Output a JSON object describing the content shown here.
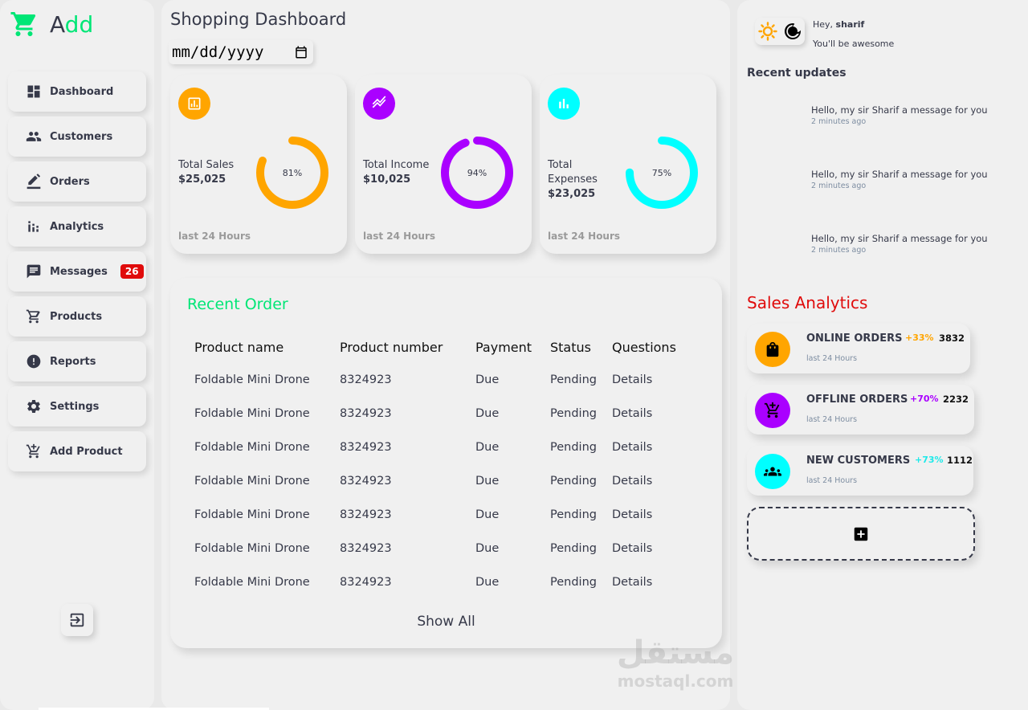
{
  "brand": {
    "first_letter": "A",
    "rest": "dd"
  },
  "sidebar": {
    "items": [
      {
        "label": "Dashboard",
        "icon": "dashboard-icon"
      },
      {
        "label": "Customers",
        "icon": "people-icon"
      },
      {
        "label": "Orders",
        "icon": "edit-icon"
      },
      {
        "label": "Analytics",
        "icon": "analytics-icon"
      },
      {
        "label": "Messages",
        "icon": "message-icon",
        "badge": "26"
      },
      {
        "label": "Products",
        "icon": "cart-icon"
      },
      {
        "label": "Reports",
        "icon": "report-icon"
      },
      {
        "label": "Settings",
        "icon": "settings-icon"
      },
      {
        "label": "Add Product",
        "icon": "add-cart-icon"
      }
    ],
    "logout_icon": "logout-icon"
  },
  "main": {
    "title": "Shopping Dashboard",
    "date_placeholder": "mm/dd/yyyy",
    "cards": [
      {
        "label": "Total Sales",
        "value": "$25,025",
        "percent": "81%",
        "fraction": 0.81,
        "color": "#ffa500",
        "footer": "last 24 Hours",
        "icon": "bar-chart-icon"
      },
      {
        "label": "Total Income",
        "value": "$10,025",
        "percent": "94%",
        "fraction": 0.94,
        "color": "#aa00ff",
        "footer": "last 24 Hours",
        "icon": "trending-icon"
      },
      {
        "label": "Total Expenses",
        "value": "$23,025",
        "percent": "75%",
        "fraction": 0.75,
        "color": "#00ffff",
        "footer": "last 24 Hours",
        "icon": "stats-icon"
      }
    ],
    "recent_order": {
      "title": "Recent Order",
      "headers": [
        "Product name",
        "Product number",
        "Payment",
        "Status",
        "Questions"
      ],
      "rows": [
        [
          "Foldable Mini Drone",
          "8324923",
          "Due",
          "Pending",
          "Details"
        ],
        [
          "Foldable Mini Drone",
          "8324923",
          "Due",
          "Pending",
          "Details"
        ],
        [
          "Foldable Mini Drone",
          "8324923",
          "Due",
          "Pending",
          "Details"
        ],
        [
          "Foldable Mini Drone",
          "8324923",
          "Due",
          "Pending",
          "Details"
        ],
        [
          "Foldable Mini Drone",
          "8324923",
          "Due",
          "Pending",
          "Details"
        ],
        [
          "Foldable Mini Drone",
          "8324923",
          "Due",
          "Pending",
          "Details"
        ],
        [
          "Foldable Mini Drone",
          "8324923",
          "Due",
          "Pending",
          "Details"
        ]
      ],
      "show_all": "Show All"
    },
    "watermark": {
      "arabic": "مستقل",
      "latin": "mostaql.com"
    }
  },
  "right": {
    "greeting_prefix": "Hey, ",
    "user": "sharif",
    "greeting_sub": "You'll be awesome",
    "recent_updates_title": "Recent updates",
    "updates": [
      {
        "message": "Hello, my sir Sharif a message for you",
        "time": "2 minutes ago"
      },
      {
        "message": "Hello, my sir Sharif a message for you",
        "time": "2 minutes ago"
      },
      {
        "message": "Hello, my sir Sharif a message for you",
        "time": "2 minutes ago"
      }
    ],
    "sales_analytics_title": "Sales Analytics",
    "analytics": [
      {
        "name": "ONLINE ORDERS",
        "growth": "+33%",
        "count": "3832",
        "sub": "last 24 Hours",
        "color": "#ffa500",
        "icon": "shopping-bag-icon"
      },
      {
        "name": "OFFLINE ORDERS",
        "growth": "+70%",
        "count": "2232",
        "sub": "last 24 Hours",
        "color": "#aa00ff",
        "icon": "add-cart-icon"
      },
      {
        "name": "NEW CUSTOMERS",
        "growth": "+73%",
        "count": "1112",
        "sub": "last 24 Hours",
        "color": "#00ffff",
        "icon": "group-icon"
      }
    ],
    "add_icon": "plus-box-icon"
  }
}
